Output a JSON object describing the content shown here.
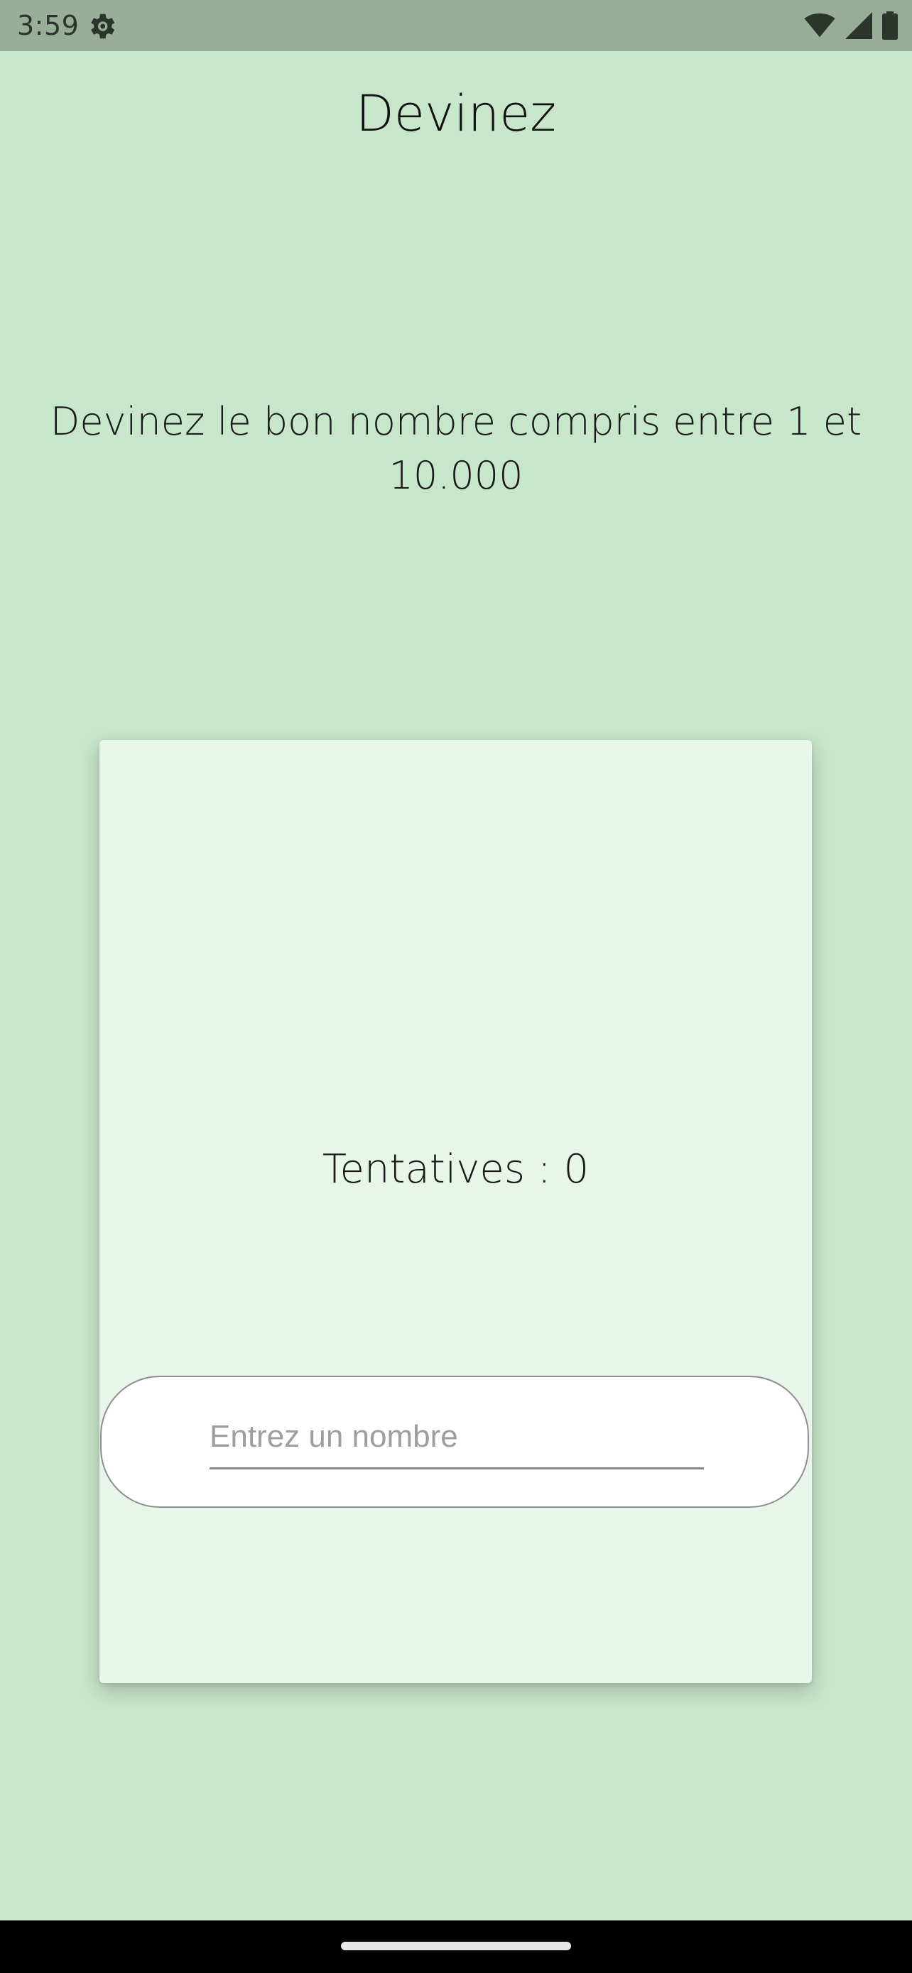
{
  "status_bar": {
    "time": "3:59",
    "icons": [
      "settings-icon",
      "wifi-icon",
      "signal-icon",
      "battery-icon"
    ]
  },
  "app": {
    "title": "Devinez"
  },
  "instructions": "Devinez le bon nombre compris entre 1 et 10.000",
  "card": {
    "attempts_label": "Tentatives : 0",
    "input": {
      "value": "",
      "placeholder": "Entrez un nombre"
    }
  },
  "colors": {
    "background": "#c8e6c9",
    "card": "#e8f5e9",
    "status_bar": "#98ae98",
    "nav_bar": "#000000"
  }
}
